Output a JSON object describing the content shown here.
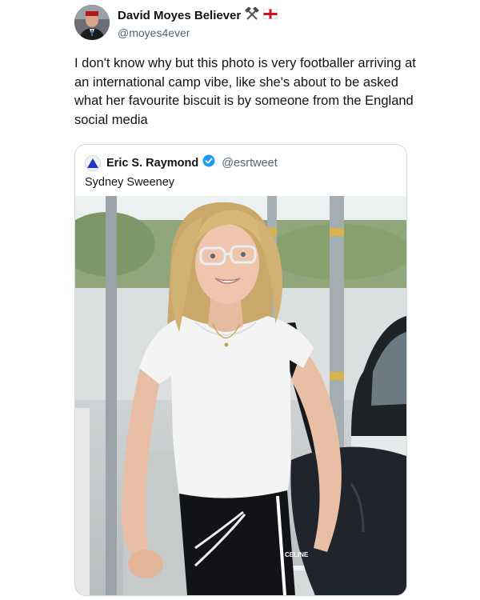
{
  "tweet": {
    "author": {
      "display_name": "David Moyes Believer",
      "handle": "@moyes4ever",
      "name_emoji": [
        "hammers-icon",
        "england-flag-icon"
      ]
    },
    "text": "I don't know why but this photo is very footballer arriving at an international camp vibe, like she's about to be asked what her favourite biscuit is by someone from the England social media"
  },
  "quoted_tweet": {
    "author": {
      "display_name": "Eric S. Raymond",
      "handle": "@esrtweet",
      "verified": true
    },
    "text": "Sydney Sweeney",
    "photo": {
      "bag_brand": "CELINE"
    }
  },
  "colors": {
    "text_primary": "#0f1419",
    "text_secondary": "#536471",
    "verified_blue": "#1d9bf0",
    "card_border": "#cfd9de"
  }
}
